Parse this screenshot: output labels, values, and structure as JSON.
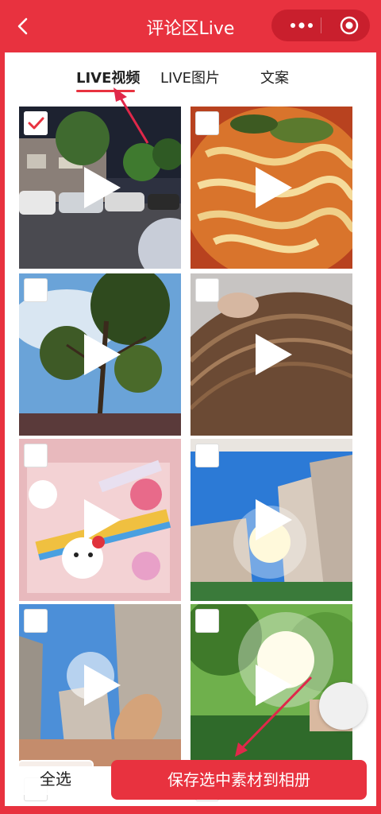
{
  "header": {
    "title": "评论区Live",
    "back_icon": "chevron-left-icon",
    "more_icon": "more-dots-icon",
    "target_icon": "target-icon"
  },
  "tabs": [
    {
      "label": "LIVE视频",
      "active": true
    },
    {
      "label": "LIVE图片",
      "active": false
    },
    {
      "label": "文案",
      "active": false
    }
  ],
  "grid": {
    "items": [
      {
        "name": "street-night",
        "checked": true
      },
      {
        "name": "noodles",
        "checked": false
      },
      {
        "name": "tree-sky",
        "checked": false
      },
      {
        "name": "hair",
        "checked": false
      },
      {
        "name": "toys-box",
        "checked": false
      },
      {
        "name": "buildings-sun",
        "checked": false
      },
      {
        "name": "buildings-hand",
        "checked": false
      },
      {
        "name": "garden-sun",
        "checked": false
      }
    ]
  },
  "footer": {
    "select_all": "全选",
    "save": "保存选中素材到相册"
  },
  "colors": {
    "accent": "#e8323f"
  }
}
